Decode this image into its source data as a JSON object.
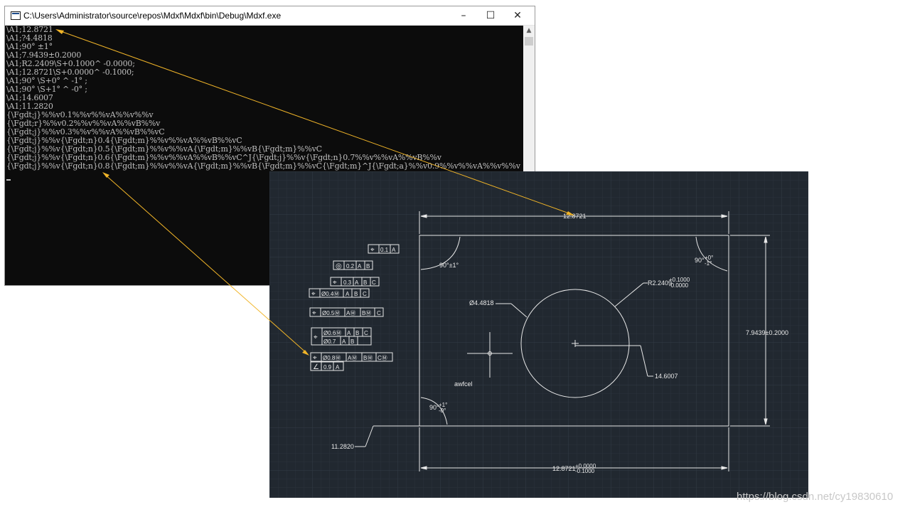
{
  "window": {
    "title": "C:\\Users\\Administrator\\source\\repos\\Mdxf\\Mdxf\\bin\\Debug\\Mdxf.exe",
    "minimize_glyph": "–",
    "maximize_glyph": "☐",
    "close_glyph": "✕",
    "scroll_up_glyph": "▲"
  },
  "console": {
    "lines": [
      "\\A1;12.8721",
      "\\A1;?4.4818",
      "\\A1;90° ±1°",
      "\\A1;7.9439±0.2000",
      "\\A1;R2.2409\\S+0.1000^ -0.0000;",
      "\\A1;12.8721\\S+0.0000^ -0.1000;",
      "\\A1;90° \\S+0° ^ -1° ;",
      "\\A1;90° \\S+1° ^ -0° ;",
      "\\A1;14.6007",
      "\\A1;11.2820",
      "{\\Fgdt;j}%%v0.1%%v%%vA%%v%%v",
      "{\\Fgdt;r}%%v0.2%%v%%vA%%vB%%v",
      "{\\Fgdt;j}%%v0.3%%v%%vA%%vB%%vC",
      "{\\Fgdt;j}%%v{\\Fgdt;n}0.4{\\Fgdt;m}%%v%%vA%%vB%%vC",
      "{\\Fgdt;j}%%v{\\Fgdt;n}0.5{\\Fgdt;m}%%v%%vA{\\Fgdt;m}%%vB{\\Fgdt;m}%%vC",
      "{\\Fgdt;j}%%v{\\Fgdt;n}0.6{\\Fgdt;m}%%v%%vA%%vB%%vC^J{\\Fgdt;j}%%v{\\Fgdt;n}0.7%%v%%vA%%vB%%v",
      "{\\Fgdt;j}%%v{\\Fgdt;n}0.8{\\Fgdt;m}%%v%%vA{\\Fgdt;m}%%vB{\\Fgdt;m}%%vC{\\Fgdt;m}^J{\\Fgdt;a}%%v0.9%%v%%vA%%v%%v"
    ]
  },
  "cad": {
    "dims": {
      "top_width": "12.8721",
      "bottom_width_base": "12.8721",
      "bottom_width_upper_tol": "+0.0000",
      "bottom_width_lower_tol": "-0.1000",
      "height": "7.9439±0.2000",
      "diameter": "Ø4.4818",
      "radius_base": "R2.2409",
      "radius_upper_tol": "+0.1000",
      "radius_lower_tol": "-0.0000",
      "angle_top_left": "90°±1°",
      "angle_top_right_base": "90°",
      "angle_top_right_upper": "+0°",
      "angle_top_right_lower": "-1°",
      "angle_bottom_left_base": "90°",
      "angle_bottom_left_upper": "+1°",
      "angle_bottom_left_lower": "-0°",
      "ordinate_horizontal": "14.6007",
      "ordinate_left": "11.2820",
      "note": "awfcel"
    },
    "fcf": [
      {
        "symbol": "position",
        "tol": "0.1",
        "datums": [
          "A"
        ]
      },
      {
        "symbol": "concentricity",
        "tol": "0.2",
        "datums": [
          "A",
          "B"
        ]
      },
      {
        "symbol": "position",
        "tol": "0.3",
        "datums": [
          "A",
          "B",
          "C"
        ]
      },
      {
        "symbol": "position",
        "tol": "Ø0.4Ⓜ",
        "datums": [
          "A",
          "B",
          "C"
        ]
      },
      {
        "symbol": "position",
        "tol": "Ø0.5Ⓜ",
        "datums": [
          "AⓂ",
          "BⓂ",
          "C"
        ]
      },
      {
        "symbol": "position",
        "tol": "Ø0.6Ⓜ",
        "datums": [
          "A",
          "B",
          "C"
        ],
        "row2_tol": "Ø0.7",
        "row2_datums": [
          "A",
          "B"
        ]
      },
      {
        "symbol": "position",
        "tol": "Ø0.8Ⓜ",
        "datums": [
          "AⓂ",
          "BⓂ",
          "CⓂ"
        ],
        "row2_symbol": "angularity",
        "row2_tol": "0.9",
        "row2_datums": [
          "A"
        ]
      }
    ]
  },
  "watermark": "https://blog.csdn.net/cy19830610",
  "colors": {
    "arrow": "#f0b428",
    "cad_background": "#212830",
    "console_background": "#0c0c0c",
    "console_text": "#c0c0c0"
  }
}
